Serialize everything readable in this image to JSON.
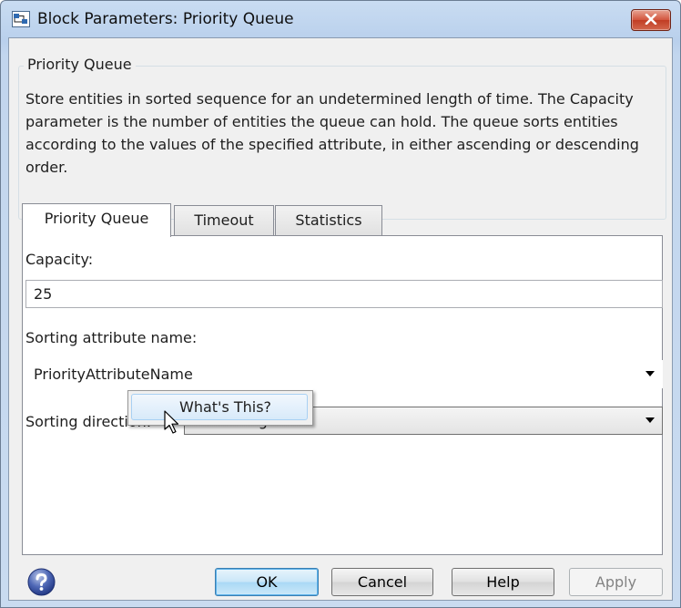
{
  "window": {
    "title": "Block Parameters: Priority Queue",
    "close_label": "close"
  },
  "group": {
    "title": "Priority Queue",
    "description": "Store entities in sorted sequence for an undetermined length of time. The Capacity parameter is the number of entities the queue can hold. The queue sorts entities according to the values of the specified attribute, in either ascending or descending order."
  },
  "tabs": [
    {
      "label": "Priority Queue",
      "active": true
    },
    {
      "label": "Timeout",
      "active": false
    },
    {
      "label": "Statistics",
      "active": false
    }
  ],
  "form": {
    "capacity_label": "Capacity:",
    "capacity_value": "25",
    "sorting_attribute_label": "Sorting attribute name:",
    "sorting_attribute_value": "PriorityAttributeName",
    "sorting_direction_label": "Sorting direction:",
    "sorting_direction_value": "Ascending"
  },
  "context_menu": {
    "items": [
      {
        "label": "What's This?"
      }
    ]
  },
  "buttons": {
    "ok": "OK",
    "cancel": "Cancel",
    "help": "Help",
    "apply": "Apply"
  },
  "icons": {
    "app": "simulink-block-icon",
    "close": "close-icon",
    "help": "help-question-icon",
    "cursor": "mouse-pointer-icon"
  },
  "colors": {
    "titlebar": "#b9d0ec",
    "close_button": "#c13d24",
    "primary_button_border": "#3c7fb1",
    "menu_highlight": "#d8eafa"
  }
}
